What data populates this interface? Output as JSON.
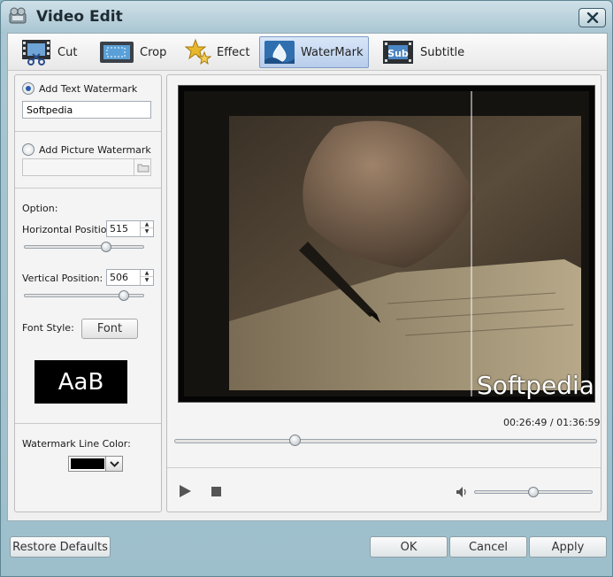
{
  "window": {
    "title": "Video Edit"
  },
  "tabs": [
    {
      "label": "Cut",
      "icon": "film-scissors-icon",
      "active": false
    },
    {
      "label": "Crop",
      "icon": "crop-screen-icon",
      "active": false
    },
    {
      "label": "Effect",
      "icon": "effect-stars-icon",
      "active": false
    },
    {
      "label": "WaterMark",
      "icon": "watermark-drop-icon",
      "active": true
    },
    {
      "label": "Subtitle",
      "icon": "subtitle-film-icon",
      "active": false
    }
  ],
  "watermark": {
    "text_option_label": "Add Text Watermark",
    "text_value": "Softpedia",
    "picture_option_label": "Add Picture Watermark",
    "picture_path": "",
    "option_heading": "Option:",
    "horizontal_label": "Horizontal Position:",
    "horizontal_value": "515",
    "horizontal_slider_fraction": 0.7,
    "vertical_label": "Vertical Position:",
    "vertical_value": "506",
    "vertical_slider_fraction": 0.86,
    "font_style_label": "Font Style:",
    "font_button": "Font",
    "preview_sample": "AaB",
    "line_color_label": "Watermark Line Color:",
    "line_color": "#000000"
  },
  "player": {
    "overlay_text": "Softpedia",
    "current_time": "00:26:49",
    "separator": "/",
    "total_time": "01:36:59",
    "progress_fraction": 0.28,
    "volume_fraction": 0.5
  },
  "footer": {
    "restore": "Restore Defaults",
    "ok": "OK",
    "cancel": "Cancel",
    "apply": "Apply"
  },
  "colors": {
    "accent": "#2a5db0",
    "active_tab": "#b8cdeb"
  }
}
